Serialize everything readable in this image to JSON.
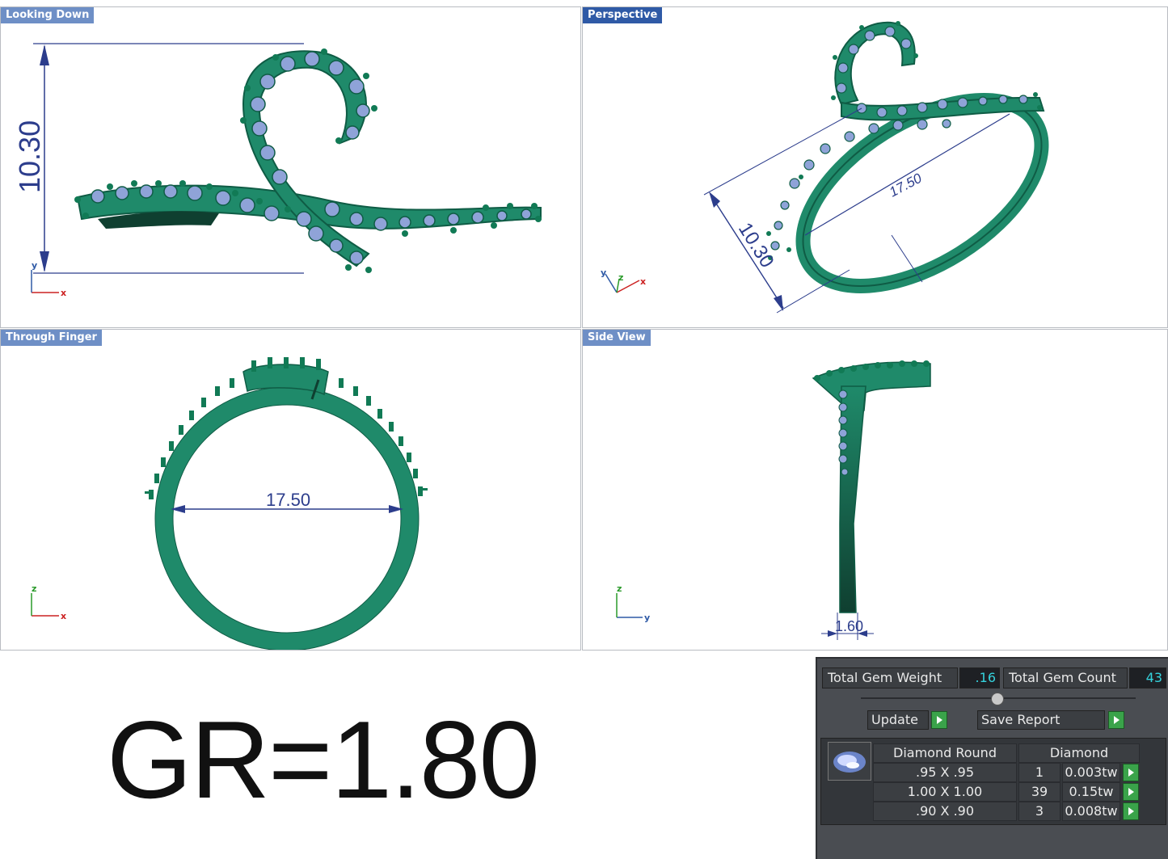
{
  "viewports": {
    "top_left": {
      "title": "Looking Down",
      "dim_label": "10.30",
      "axis_x": "x",
      "axis_y": "y"
    },
    "top_right": {
      "title": "Perspective",
      "dim_label_a": "17.50",
      "dim_label_b": "10.30",
      "axis_x": "x",
      "axis_y": "y",
      "axis_z": "z"
    },
    "bottom_left": {
      "title": "Through Finger",
      "dim_label": "17.50",
      "axis_x": "x",
      "axis_z": "z"
    },
    "bottom_right": {
      "title": "Side View",
      "dim_label": "1.60",
      "axis_y": "y",
      "axis_z": "z"
    }
  },
  "gr_label": "GR=1.80",
  "gem_panel": {
    "total_weight_label": "Total Gem Weight",
    "total_weight_value": ".16",
    "total_count_label": "Total Gem Count",
    "total_count_value": "43",
    "update_label": "Update",
    "save_report_label": "Save Report",
    "table": {
      "headers": [
        "Diamond Round",
        "Diamond"
      ],
      "rows": [
        {
          "size": ".95 X .95",
          "count": "1",
          "weight": "0.003tw"
        },
        {
          "size": "1.00 X 1.00",
          "count": "39",
          "weight": "0.15tw"
        },
        {
          "size": ".90 X .90",
          "count": "3",
          "weight": "0.008tw"
        }
      ]
    }
  },
  "colors": {
    "metal": "#1f8a6a",
    "metal_dark": "#0f5c45",
    "gem": "#8fa3d8",
    "dimension": "#2c3d8c",
    "viewport_title_active": "#2f5aa6",
    "viewport_title": "#6e8fc6"
  }
}
